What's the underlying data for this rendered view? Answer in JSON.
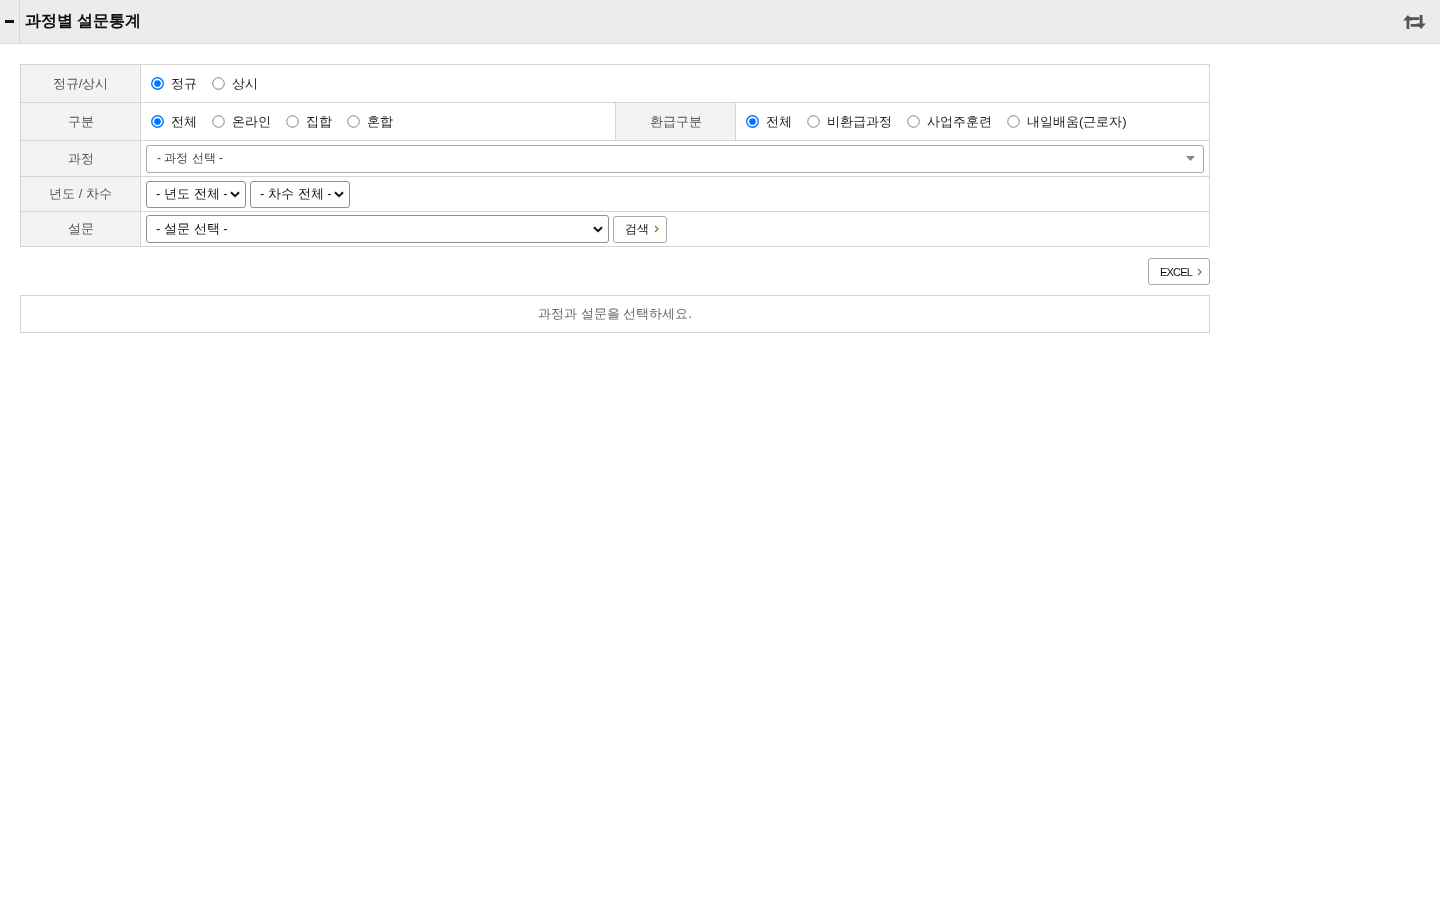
{
  "header": {
    "title": "과정별 설문통계"
  },
  "filters": [
    {
      "cells": [
        {
          "label": "정규/상시",
          "kind": "radio",
          "options": [
            {
              "label": "정규",
              "selected": true
            },
            {
              "label": "상시",
              "selected": false
            }
          ]
        }
      ]
    },
    {
      "cells": [
        {
          "label": "구분",
          "kind": "radio",
          "options": [
            {
              "label": "전체",
              "selected": true
            },
            {
              "label": "온라인",
              "selected": false
            },
            {
              "label": "집합",
              "selected": false
            },
            {
              "label": "혼합",
              "selected": false
            }
          ]
        },
        {
          "label": "환급구분",
          "kind": "radio",
          "options": [
            {
              "label": "전체",
              "selected": true
            },
            {
              "label": "비환급과정",
              "selected": false
            },
            {
              "label": "사업주훈련",
              "selected": false
            },
            {
              "label": "내일배움(근로자)",
              "selected": false
            }
          ]
        }
      ]
    },
    {
      "cells": [
        {
          "label": "과정",
          "kind": "combo",
          "value": "- 과정 선택 -"
        }
      ]
    },
    {
      "cells": [
        {
          "label": "년도 / 차수",
          "kind": "select",
          "selects": [
            {
              "value": "- 년도 전체 -"
            },
            {
              "value": "- 차수 전체 -"
            }
          ]
        }
      ]
    },
    {
      "cells": [
        {
          "label": "설문",
          "kind": "select",
          "selects": [
            {
              "value": "- 설문 선택 -"
            }
          ],
          "button": "검색"
        }
      ]
    }
  ],
  "excel_button": "EXCEL",
  "message": "과정과 설문을 선택하세요."
}
